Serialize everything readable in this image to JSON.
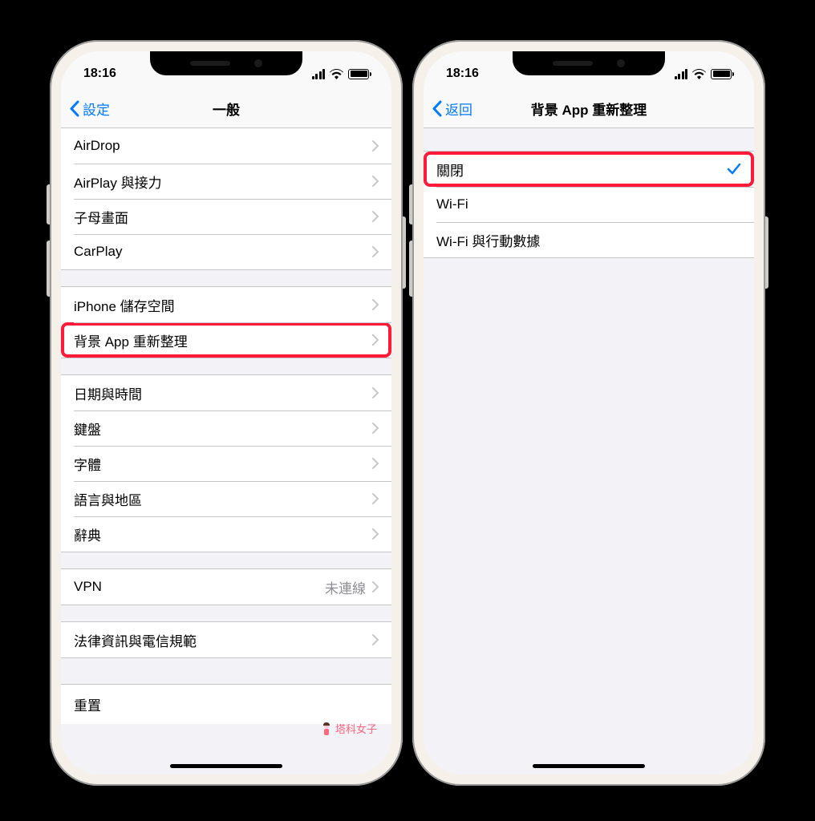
{
  "status": {
    "time": "18:16"
  },
  "phone1": {
    "back_label": "設定",
    "title": "一般",
    "sections": [
      {
        "rows": [
          {
            "label": "AirDrop"
          },
          {
            "label": "AirPlay 與接力"
          },
          {
            "label": "子母畫面"
          },
          {
            "label": "CarPlay"
          }
        ]
      },
      {
        "rows": [
          {
            "label": "iPhone 儲存空間"
          },
          {
            "label": "背景 App 重新整理",
            "highlighted": true
          }
        ]
      },
      {
        "rows": [
          {
            "label": "日期與時間"
          },
          {
            "label": "鍵盤"
          },
          {
            "label": "字體"
          },
          {
            "label": "語言與地區"
          },
          {
            "label": "辭典"
          }
        ]
      },
      {
        "rows": [
          {
            "label": "VPN",
            "value": "未連線"
          }
        ]
      },
      {
        "rows": [
          {
            "label": "法律資訊與電信規範"
          }
        ]
      }
    ],
    "footer_row": "重置"
  },
  "phone2": {
    "back_label": "返回",
    "title": "背景 App 重新整理",
    "rows": [
      {
        "label": "關閉",
        "checked": true,
        "highlighted": true
      },
      {
        "label": "Wi-Fi"
      },
      {
        "label": "Wi-Fi 與行動數據"
      }
    ]
  },
  "watermark": "塔科女子"
}
